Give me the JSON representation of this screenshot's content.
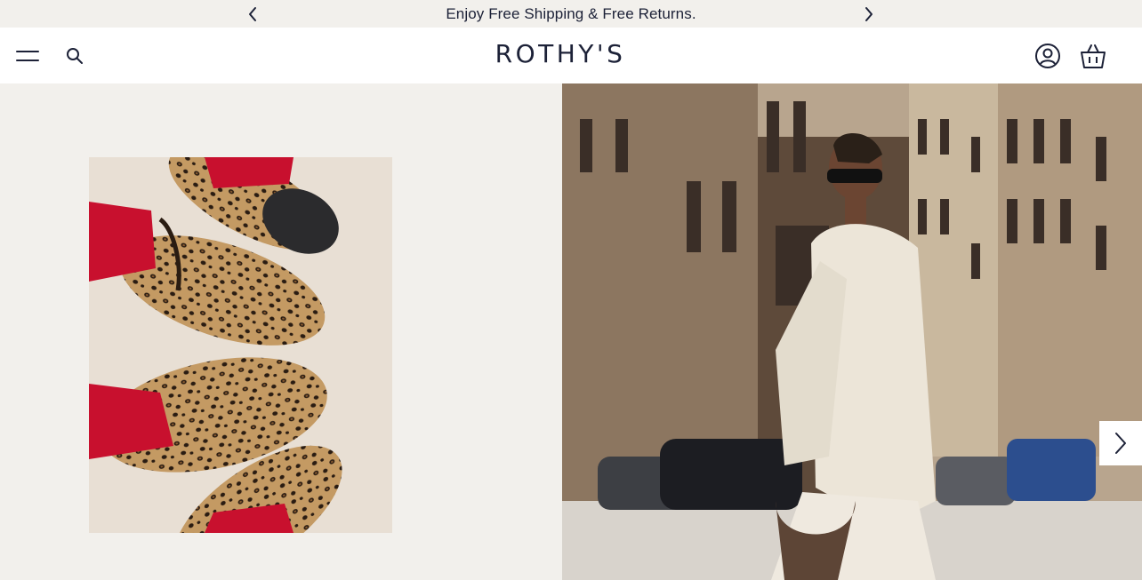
{
  "announcement": {
    "text": "Enjoy Free Shipping & Free Returns.",
    "prev_icon": "chevron-left-icon",
    "next_icon": "chevron-right-icon"
  },
  "header": {
    "logo": "ROTHY'S",
    "icons": [
      "menu-icon",
      "search-icon",
      "account-icon",
      "shopping-bag-icon"
    ]
  },
  "hero": {
    "product_image": "leopard-print-loafers-photo",
    "lifestyle_image": "woman-walking-city-street-photo",
    "next_icon": "chevron-right-icon"
  },
  "colors": {
    "navy": "#1c2137",
    "background": "#f2f0ec",
    "header_bg": "#ffffff",
    "accent_red": "#c8102e"
  }
}
